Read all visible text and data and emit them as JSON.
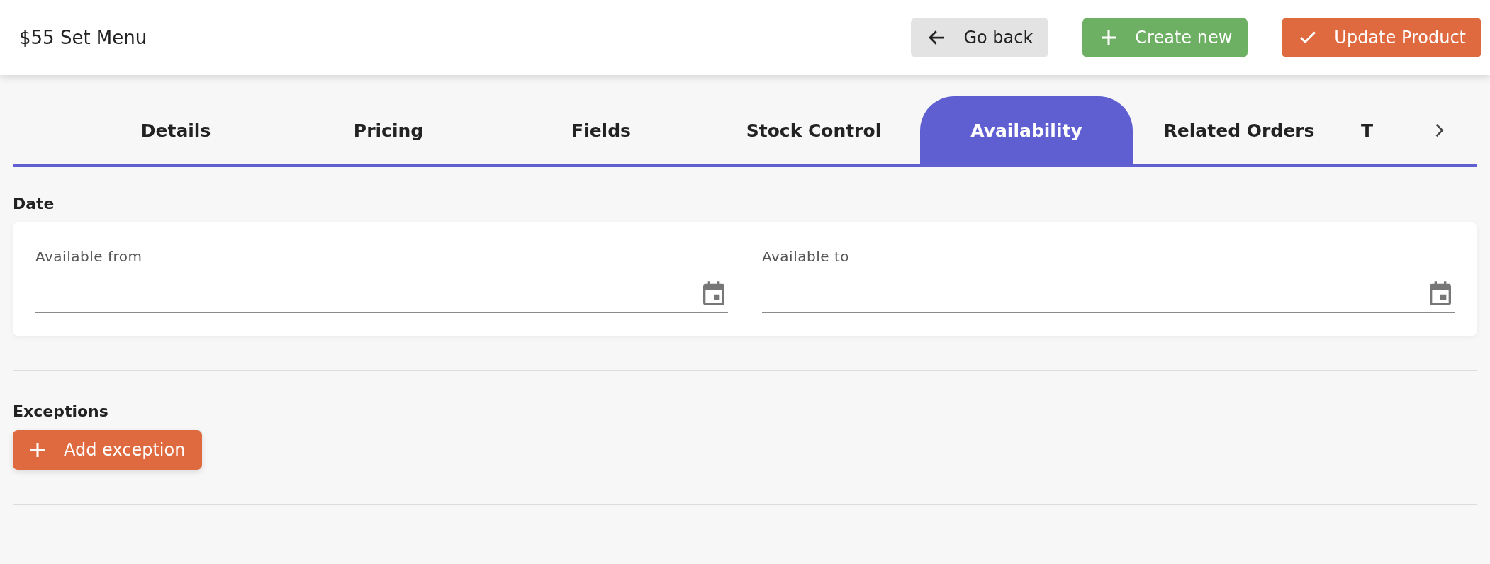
{
  "header": {
    "title": "$55 Set Menu",
    "buttons": [
      {
        "kind": "back",
        "label": "Go back"
      },
      {
        "kind": "create",
        "label": "Create new"
      },
      {
        "kind": "update",
        "label": "Update Product"
      }
    ]
  },
  "tabs": [
    {
      "label": "Details",
      "selected": false
    },
    {
      "label": "Pricing",
      "selected": false
    },
    {
      "label": "Fields",
      "selected": false
    },
    {
      "label": "Stock Control",
      "selected": false
    },
    {
      "label": "Availability",
      "selected": true
    },
    {
      "label": "Related Orders",
      "selected": false
    },
    {
      "label": "T",
      "selected": false
    }
  ],
  "date_section": {
    "title": "Date",
    "fields": [
      {
        "label": "Available from"
      },
      {
        "label": "Available to"
      }
    ]
  },
  "exceptions_section": {
    "title": "Exceptions",
    "button": "Add exception"
  }
}
